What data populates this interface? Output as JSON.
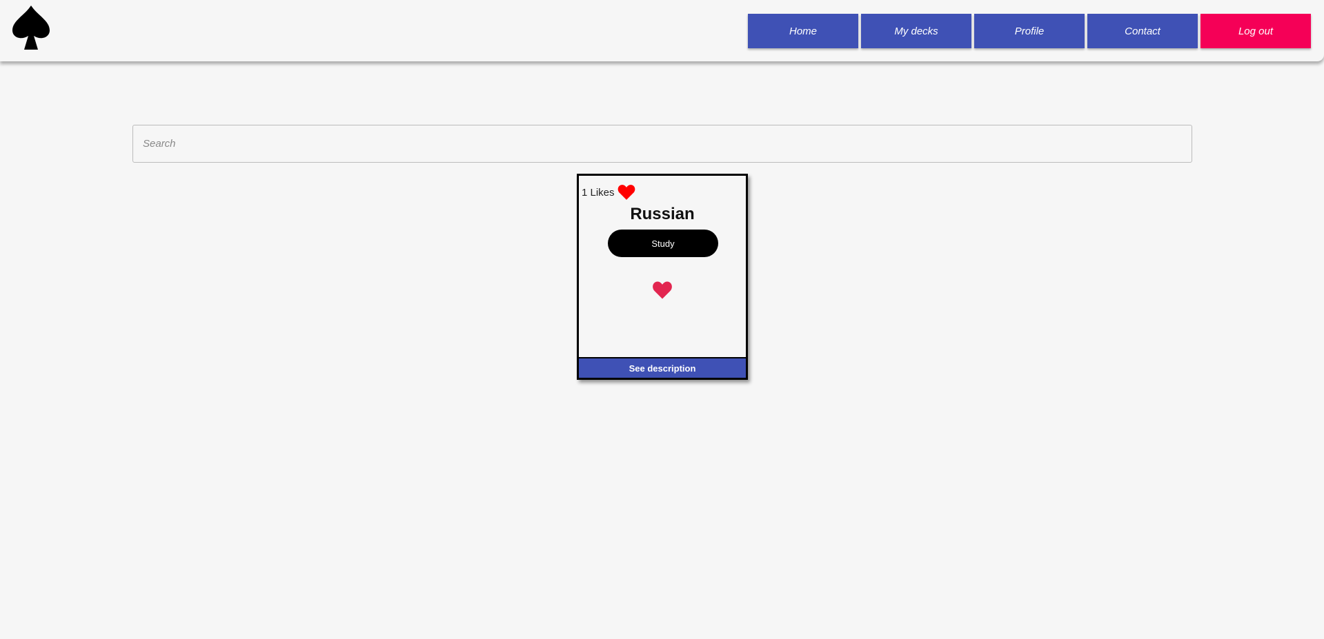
{
  "nav": {
    "items": [
      "Home",
      "My decks",
      "Profile",
      "Contact"
    ],
    "logout": "Log out"
  },
  "search": {
    "placeholder": "Search"
  },
  "deck": {
    "likes": "1 Likes",
    "title": "Russian",
    "study": "Study",
    "description": "See description"
  },
  "colors": {
    "primary": "#3f51b5",
    "accent": "#f50057",
    "heart": "#ff0000",
    "like_button": "#e22650"
  }
}
